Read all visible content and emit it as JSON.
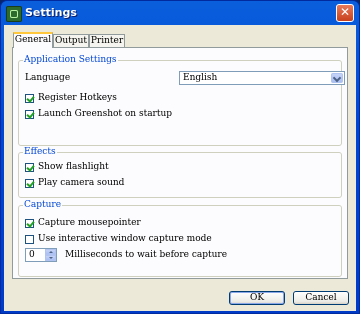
{
  "window": {
    "title": "Settings"
  },
  "tabs": [
    {
      "label": "General",
      "active": true
    },
    {
      "label": "Output",
      "active": false
    },
    {
      "label": "Printer",
      "active": false
    }
  ],
  "application_settings": {
    "title": "Application Settings",
    "language_label": "Language",
    "language_value": "English",
    "register_hotkeys": {
      "label": "Register Hotkeys",
      "checked": true
    },
    "launch_on_startup": {
      "label": "Launch Greenshot on startup",
      "checked": true
    }
  },
  "effects": {
    "title": "Effects",
    "show_flashlight": {
      "label": "Show flashlight",
      "checked": true
    },
    "play_camera_sound": {
      "label": "Play camera sound",
      "checked": true
    }
  },
  "capture": {
    "title": "Capture",
    "capture_mousepointer": {
      "label": "Capture mousepointer",
      "checked": true
    },
    "interactive_window_mode": {
      "label": "Use interactive window capture mode",
      "checked": false
    },
    "wait_value": "0",
    "wait_label": "Milliseconds to wait before capture"
  },
  "buttons": {
    "ok": "OK",
    "cancel": "Cancel"
  },
  "colors": {
    "title_bar": "#0046d5",
    "group_title": "#0046d5",
    "dialog_bg": "#ece9d8"
  }
}
